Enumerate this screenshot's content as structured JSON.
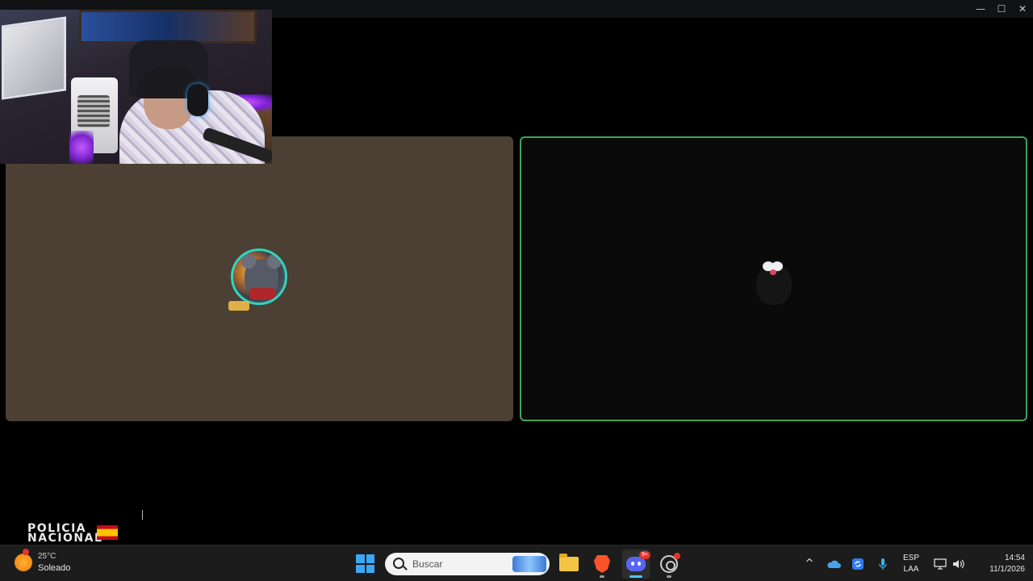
{
  "window": {
    "minimize_glyph": "—",
    "maximize_glyph": "☐",
    "close_glyph": "✕"
  },
  "tiles": [
    {
      "id": "left",
      "background": "#4b4033",
      "speaking": false,
      "avatar": "mouse-character-avatar"
    },
    {
      "id": "right",
      "background": "#0a0a0a",
      "speaking": true,
      "speaking_color": "#3ba55c",
      "avatar": "dark-mouse-avatar"
    }
  ],
  "overlay": {
    "logo_line1": "POLICIA",
    "logo_line2": "NACIONAL"
  },
  "taskbar": {
    "weather": {
      "temp": "25°C",
      "condition": "Soleado",
      "icon": "sun-icon"
    },
    "search": {
      "placeholder": "Buscar"
    },
    "apps": [
      {
        "name": "start-button",
        "icon": "windows-icon"
      },
      {
        "name": "file-explorer",
        "icon": "folder-icon"
      },
      {
        "name": "brave-browser",
        "icon": "brave-icon"
      },
      {
        "name": "discord",
        "icon": "discord-icon",
        "badge": "9+",
        "active": true
      },
      {
        "name": "obs-studio",
        "icon": "obs-icon"
      }
    ],
    "tray": {
      "chevron": "^",
      "lang_line1": "ESP",
      "lang_line2": "LAA",
      "time": "14:54",
      "date": "11/1/2026"
    }
  }
}
